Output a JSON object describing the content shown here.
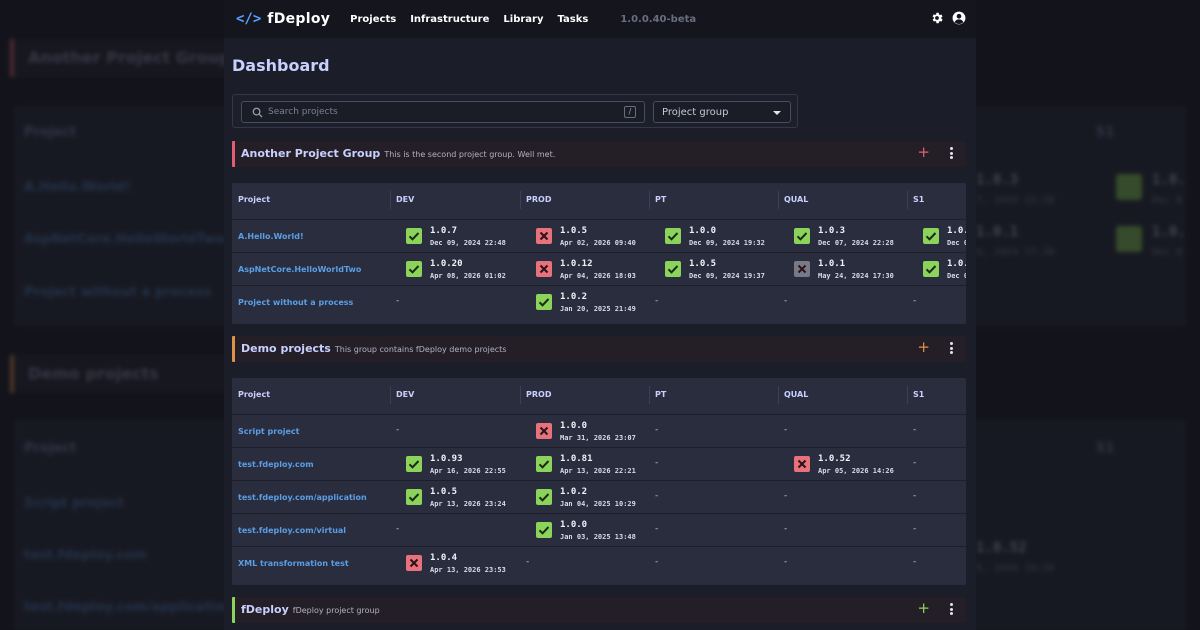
{
  "app": {
    "logo_icon": "</>",
    "name": "fDeploy",
    "nav": [
      "Projects",
      "Infrastructure",
      "Library",
      "Tasks"
    ],
    "version": "1.0.0.40-beta"
  },
  "dashboard": {
    "title": "Dashboard",
    "search_placeholder": "Search projects",
    "search_shortcut": "/",
    "group_select": "Project group"
  },
  "columns": [
    "Project",
    "DEV",
    "PROD",
    "PT",
    "QUAL",
    "S1"
  ],
  "groups": [
    {
      "name": "Another Project Group",
      "description": "This is the second project group. Well met.",
      "accent": "#e06070",
      "rows": [
        {
          "project": "A.Hello.World!",
          "cells": [
            {
              "status": "ok",
              "version": "1.0.7",
              "date": "Dec 09, 2024 22:48"
            },
            {
              "status": "fail",
              "version": "1.0.5",
              "date": "Apr 02, 2026 09:40"
            },
            {
              "status": "ok",
              "version": "1.0.0",
              "date": "Dec 09, 2024 19:32"
            },
            {
              "status": "ok",
              "version": "1.0.3",
              "date": "Dec 07, 2024 22:28"
            },
            {
              "status": "ok",
              "version": "1.0.",
              "date": "Dec 0"
            }
          ]
        },
        {
          "project": "AspNetCore.HelloWorldTwo",
          "cells": [
            {
              "status": "ok",
              "version": "1.0.20",
              "date": "Apr 08, 2026 01:02"
            },
            {
              "status": "fail",
              "version": "1.0.12",
              "date": "Apr 04, 2026 18:03"
            },
            {
              "status": "ok",
              "version": "1.0.5",
              "date": "Dec 09, 2024 19:37"
            },
            {
              "status": "cancel",
              "version": "1.0.1",
              "date": "May 24, 2024 17:30"
            },
            {
              "status": "ok",
              "version": "1.0.",
              "date": "Dec 0"
            }
          ]
        },
        {
          "project": "Project without a process",
          "cells": [
            null,
            {
              "status": "ok",
              "version": "1.0.2",
              "date": "Jan 20, 2025 21:49"
            },
            null,
            null,
            null
          ]
        }
      ]
    },
    {
      "name": "Demo projects",
      "description": "This group contains fDeploy demo projects",
      "accent": "#e0904a",
      "rows": [
        {
          "project": "Script project",
          "cells": [
            null,
            {
              "status": "fail",
              "version": "1.0.0",
              "date": "Mar 31, 2026 23:07"
            },
            null,
            null,
            null
          ]
        },
        {
          "project": "test.fdeploy.com",
          "cells": [
            {
              "status": "ok",
              "version": "1.0.93",
              "date": "Apr 16, 2026 22:55"
            },
            {
              "status": "ok",
              "version": "1.0.81",
              "date": "Apr 13, 2026 22:21"
            },
            null,
            {
              "status": "fail",
              "version": "1.0.52",
              "date": "Apr 05, 2026 14:26"
            },
            null
          ]
        },
        {
          "project": "test.fdeploy.com/application",
          "cells": [
            {
              "status": "ok",
              "version": "1.0.5",
              "date": "Apr 13, 2026 23:24"
            },
            {
              "status": "ok",
              "version": "1.0.2",
              "date": "Jan 04, 2025 10:29"
            },
            null,
            null,
            null
          ]
        },
        {
          "project": "test.fdeploy.com/virtual",
          "cells": [
            null,
            {
              "status": "ok",
              "version": "1.0.0",
              "date": "Jan 03, 2025 13:48"
            },
            null,
            null,
            null
          ]
        },
        {
          "project": "XML transformation test",
          "cells": [
            {
              "status": "fail",
              "version": "1.0.4",
              "date": "Apr 13, 2026 23:53"
            },
            null,
            null,
            null,
            null
          ]
        }
      ]
    },
    {
      "name": "fDeploy",
      "description": "fDeploy project group",
      "accent": "#8bd35a",
      "rows": []
    }
  ],
  "empty_cell": "-",
  "backdrop": {
    "group1": "Another Project Group",
    "group2": "Demo projects",
    "header": "Project",
    "rows1": [
      "A.Hello.World!",
      "AspNetCore.HelloWorldTwo",
      "Project without a process"
    ],
    "rows2": [
      "Script project",
      "test.fdeploy.com",
      "test.fdeploy.com/application"
    ],
    "right_col": "S1",
    "right_ver1": "1.0.",
    "right_date1": "Dec 0",
    "right_ver2": "1.0.",
    "right_date2": "Dec 0",
    "right_left_ver1": "1.0.3",
    "right_left_date1": "7, 2024 22:28",
    "right_left_ver2": "1.0.1",
    "right_left_date2": "4, 2024 17:30",
    "right_left_ver3": "1.0.52",
    "right_left_date3": "5, 2026 14:26"
  },
  "colors": {
    "ok": "#8bd35a",
    "fail": "#e8727c",
    "cancel": "#777a86",
    "accent_blue": "#5aa0ff",
    "title": "#c8d0ff"
  }
}
